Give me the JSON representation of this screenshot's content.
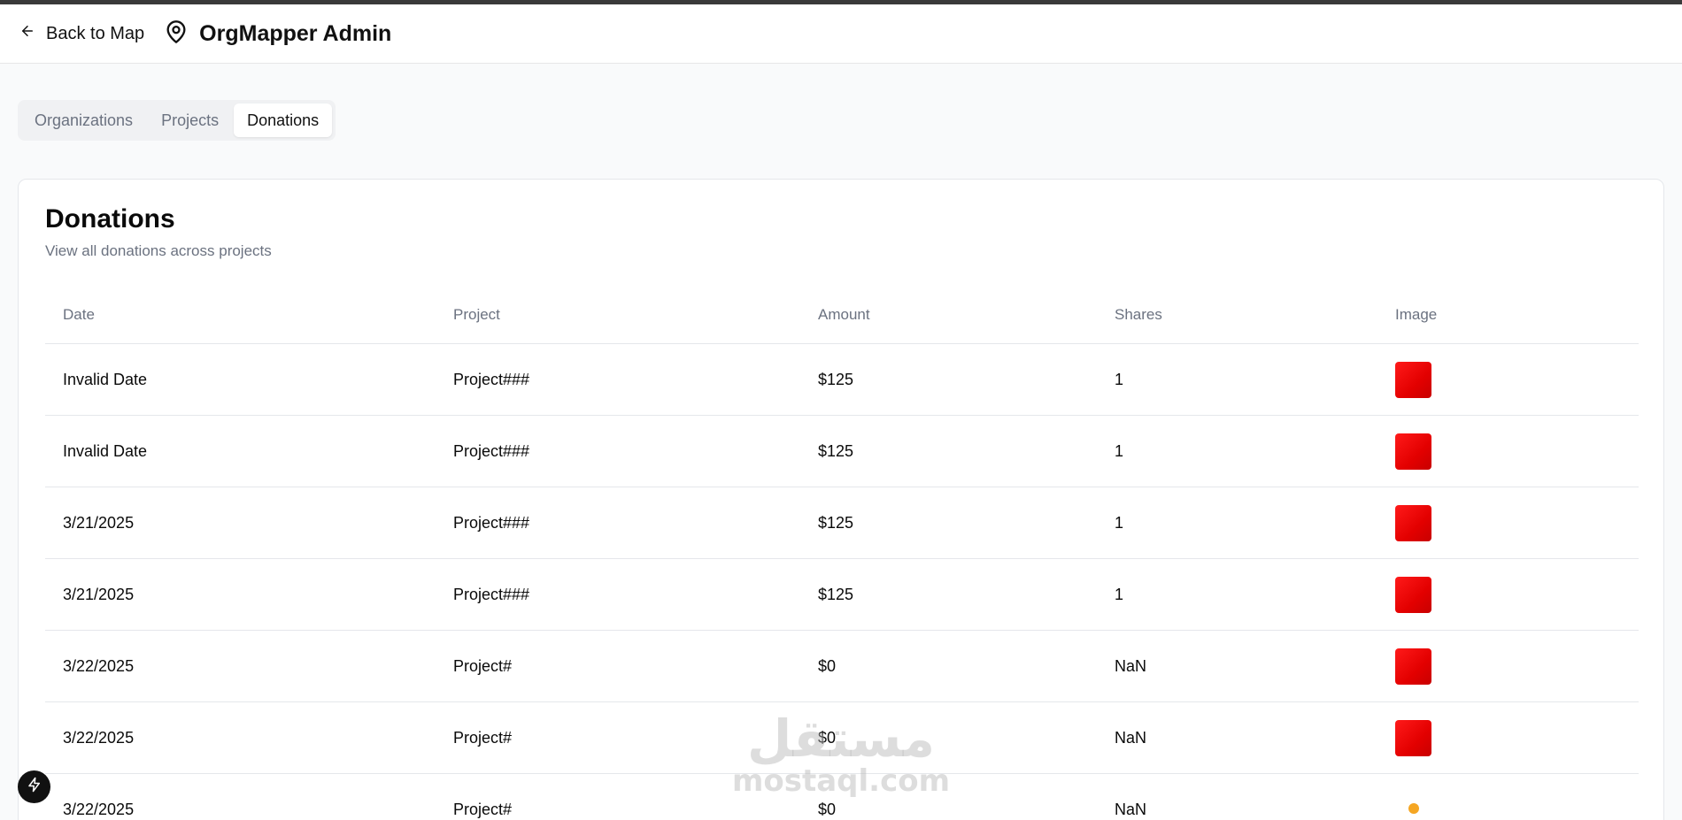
{
  "header": {
    "back_label": "Back to Map",
    "title": "OrgMapper Admin"
  },
  "tabs": [
    {
      "label": "Organizations",
      "active": false
    },
    {
      "label": "Projects",
      "active": false
    },
    {
      "label": "Donations",
      "active": true
    }
  ],
  "card": {
    "title": "Donations",
    "subtitle": "View all donations across projects"
  },
  "table": {
    "columns": [
      "Date",
      "Project",
      "Amount",
      "Shares",
      "Image"
    ],
    "rows": [
      {
        "date": "Invalid Date",
        "project": "Project###",
        "amount": "$125",
        "shares": "1",
        "image": "red-image"
      },
      {
        "date": "Invalid Date",
        "project": "Project###",
        "amount": "$125",
        "shares": "1",
        "image": "red-image"
      },
      {
        "date": "3/21/2025",
        "project": "Project###",
        "amount": "$125",
        "shares": "1",
        "image": "red-image"
      },
      {
        "date": "3/21/2025",
        "project": "Project###",
        "amount": "$125",
        "shares": "1",
        "image": "red-image"
      },
      {
        "date": "3/22/2025",
        "project": "Project#",
        "amount": "$0",
        "shares": "NaN",
        "image": "red-image"
      },
      {
        "date": "3/22/2025",
        "project": "Project#",
        "amount": "$0",
        "shares": "NaN",
        "image": "red-image"
      },
      {
        "date": "3/22/2025",
        "project": "Project#",
        "amount": "$0",
        "shares": "NaN",
        "image": "logo-image"
      }
    ]
  },
  "watermark": {
    "arabic": "مستقل",
    "latin": "mostaql.com"
  },
  "colors": {
    "accent_red": "#e30000",
    "text_primary": "#0a0a0a",
    "text_muted": "#6b7280",
    "background": "#f9fafb"
  },
  "icons": {
    "back": "arrow-left-icon",
    "brand": "map-pin-icon",
    "fab": "lightning-icon"
  }
}
